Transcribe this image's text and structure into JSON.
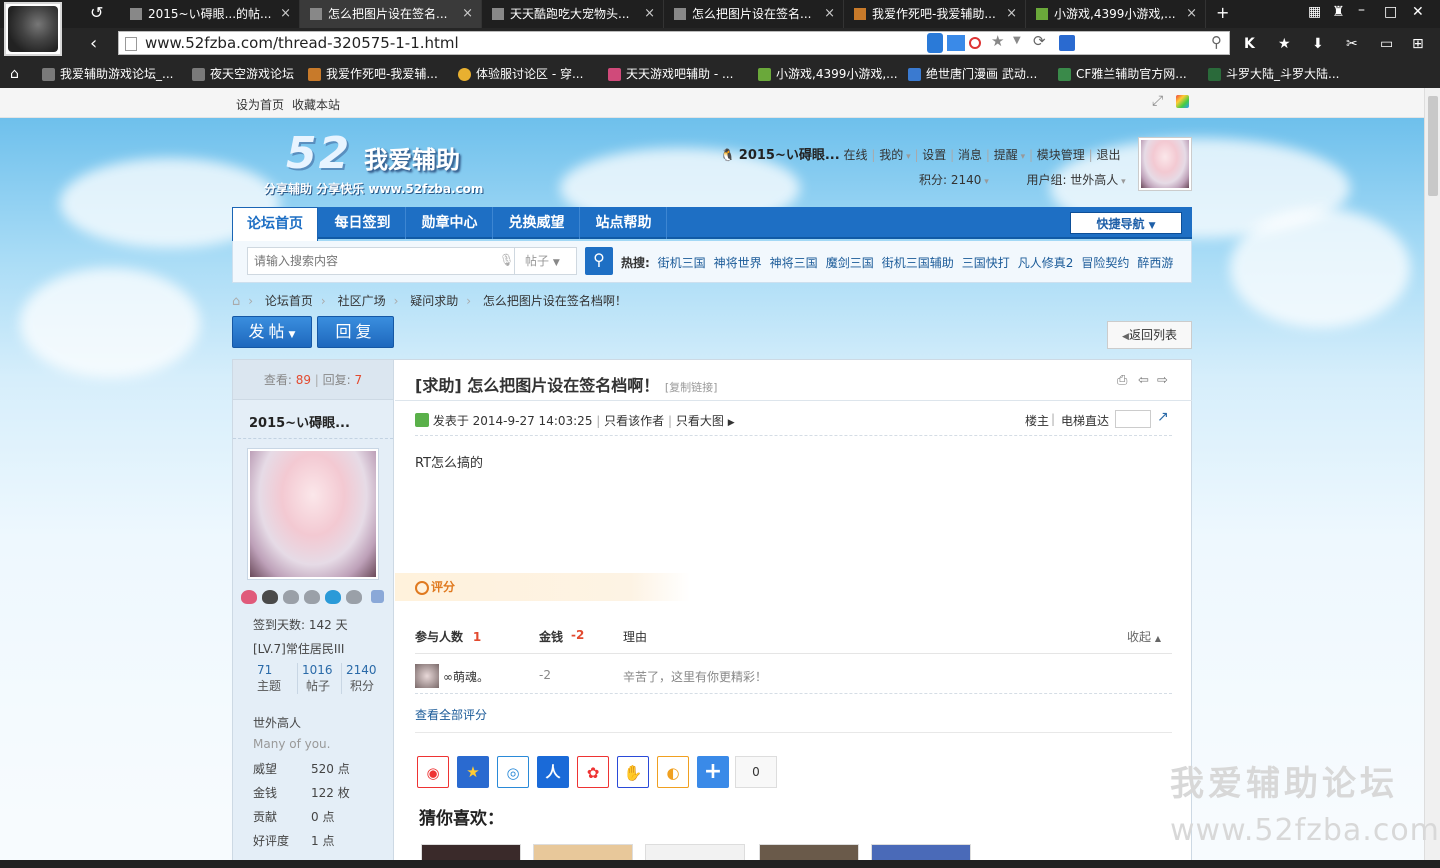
{
  "browser": {
    "tabs": [
      {
        "label": "2015~い碍眼...的帖..."
      },
      {
        "label": "怎么把图片设在签名..."
      },
      {
        "label": "天天酷跑吃大宠物头..."
      },
      {
        "label": "怎么把图片设在签名..."
      },
      {
        "label": "我爱作死吧-我爱辅助..."
      },
      {
        "label": "小游戏,4399小游戏,..."
      }
    ],
    "tab_close": "×",
    "new_tab": "+",
    "url": "www.52fzba.com/thread-320575-1-1.html",
    "bookmarks": [
      {
        "label": "我爱辅助游戏论坛_..."
      },
      {
        "label": "夜天空游戏论坛"
      },
      {
        "label": "我爱作死吧-我爱辅..."
      },
      {
        "label": "体验服讨论区 - 穿..."
      },
      {
        "label": "天天游戏吧辅助 - ..."
      },
      {
        "label": "小游戏,4399小游戏,..."
      },
      {
        "label": "绝世唐门漫画 武动..."
      },
      {
        "label": "CF雅兰辅助官方网..."
      },
      {
        "label": "斗罗大陆_斗罗大陆..."
      }
    ]
  },
  "site_top": {
    "set_home": "设为首页",
    "bookmark": "收藏本站"
  },
  "logo": {
    "num": "52",
    "name": "我爱辅助",
    "sub": "分享辅助 分享快乐 www.52fzba.com"
  },
  "user": {
    "name": "2015~い碍眼...",
    "status": "在线",
    "links": [
      "我的",
      "设置",
      "消息",
      "提醒",
      "模块管理",
      "退出"
    ],
    "score": "积分: 2140",
    "group": "用户组: 世外高人"
  },
  "nav": {
    "items": [
      "论坛首页",
      "每日签到",
      "勋章中心",
      "兑换威望",
      "站点帮助"
    ],
    "quick": "快捷导航"
  },
  "search": {
    "placeholder": "请输入搜索内容",
    "type": "帖子",
    "hot_label": "热搜:",
    "hot": [
      "街机三国",
      "神将世界",
      "神将三国",
      "魔剑三国",
      "街机三国辅助",
      "三国快打",
      "凡人修真2",
      "冒险契约",
      "醉西游"
    ]
  },
  "breadcrumb": [
    "论坛首页",
    "社区广场",
    "疑问求助",
    "怎么把图片设在签名档啊！"
  ],
  "buttons": {
    "post": "发帖",
    "reply": "回复",
    "back": "返回列表"
  },
  "stats": {
    "view_label": "查看:",
    "views": "89",
    "reply_label": "回复:",
    "replies": "7"
  },
  "author": {
    "name": "2015~い碍眼...",
    "sign_days": "签到天数: 142 天",
    "level": "[LV.7]常住居民III",
    "counts": [
      {
        "num": "71",
        "label": "主题"
      },
      {
        "num": "1016",
        "label": "帖子"
      },
      {
        "num": "2140",
        "label": "积分"
      }
    ],
    "title": "世外高人",
    "motto": "Many of you.",
    "props": [
      {
        "k": "威望",
        "v": "520 点"
      },
      {
        "k": "金钱",
        "v": "122 枚"
      },
      {
        "k": "贡献",
        "v": "0 点"
      },
      {
        "k": "好评度",
        "v": "1 点"
      }
    ]
  },
  "post": {
    "prefix": "[求助]",
    "title": "怎么把图片设在签名档啊！",
    "copy_link": "[复制链接]",
    "posted": "发表于 2014-9-27 14:03:25",
    "only_author": "只看该作者",
    "only_big": "只看大图",
    "floor": "楼主",
    "elevator": "电梯直达",
    "body": "RT怎么搞的"
  },
  "rating": {
    "tab": "评分",
    "col_people": "参与人数",
    "people": "1",
    "col_money": "金钱",
    "money": "-2",
    "col_reason": "理由",
    "collapse": "收起",
    "rater": "∞萌魂。",
    "rater_money": "-2",
    "reason": "辛苦了，这里有你更精彩！",
    "view_all": "查看全部评分"
  },
  "share": {
    "count": "0"
  },
  "guess": "猜你喜欢：",
  "watermark": {
    "line1": "我爱辅助论坛",
    "line2": "www.52fzba.com"
  }
}
